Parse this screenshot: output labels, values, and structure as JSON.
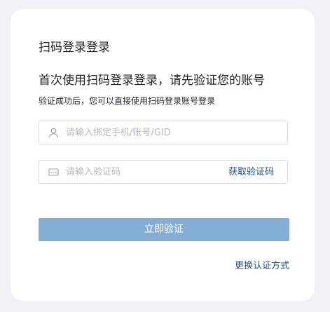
{
  "login": {
    "title": "扫码登录登录",
    "headline": "首次使用扫码登录登录，请先验证您的账号",
    "subline": "验证成功后，您可以直接使用扫码登录账号登录"
  },
  "form": {
    "phone_placeholder": "请输入绑定手机/账号/GID",
    "phone_value": "",
    "code_placeholder": "请输入验证码",
    "code_value": "",
    "get_code_label": "获取验证码",
    "submit_label": "立即验证",
    "switch_method_label": "更换认证方式"
  },
  "icons": {
    "phone_field_icon": "user-icon",
    "code_field_icon": "keypad-icon"
  },
  "colors": {
    "accent": "#1d4f91",
    "submit_bg": "#84aed5",
    "page_bg": "#f1f2f8"
  }
}
